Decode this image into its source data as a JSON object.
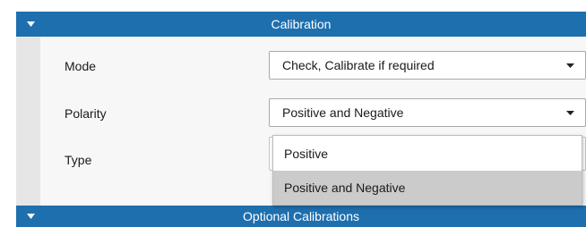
{
  "calibration": {
    "header": "Calibration",
    "mode": {
      "label": "Mode",
      "value": "Check, Calibrate if required"
    },
    "polarity": {
      "label": "Polarity",
      "value": "Positive and Negative"
    },
    "type": {
      "label": "Type",
      "value": ""
    },
    "polarity_options": [
      "Positive",
      "Positive and Negative"
    ],
    "polarity_selected": "Positive and Negative"
  },
  "optional": {
    "header": "Optional Calibrations"
  },
  "icons": {
    "section_toggle": "caret-down-icon",
    "dropdown_arrow": "dropdown-arrow-icon"
  },
  "colors": {
    "header_bg": "#1e6fae",
    "selected_option_bg": "#cbcbcb"
  }
}
